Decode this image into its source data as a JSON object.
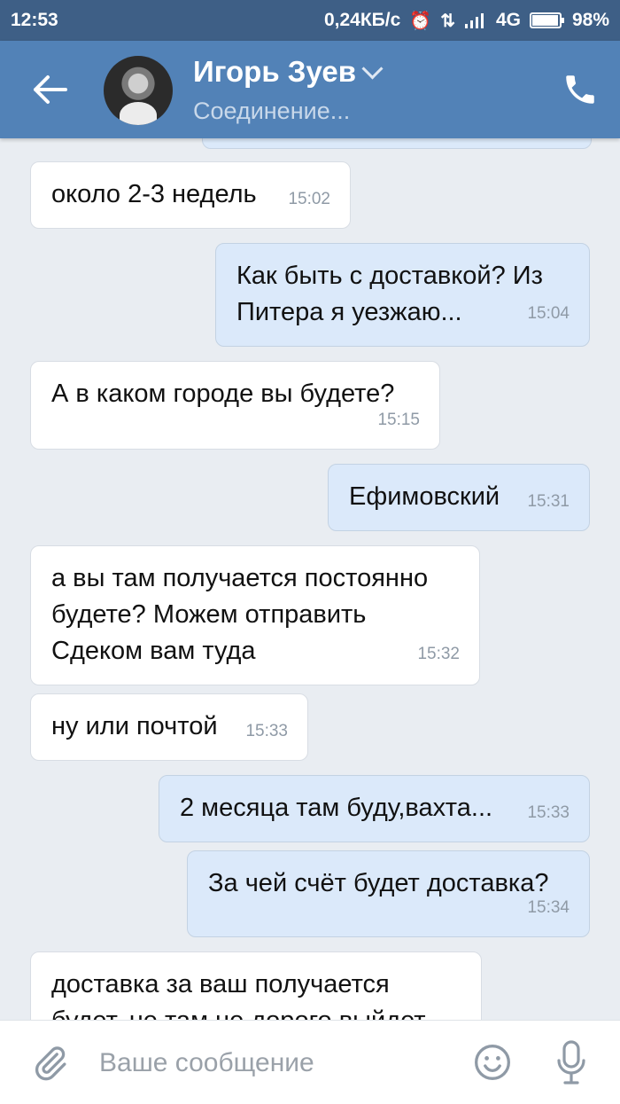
{
  "status_bar": {
    "time": "12:53",
    "net_speed": "0,24КБ/с",
    "network": "4G",
    "battery": "98%",
    "battery_level": 0.98,
    "icons": [
      "alarm-icon",
      "data-transfer-icon",
      "signal-icon",
      "battery-icon"
    ]
  },
  "header": {
    "contact_name": "Игорь Зуев",
    "status": "Соединение...",
    "icons": [
      "back-arrow-icon",
      "avatar",
      "chevron-down-icon",
      "phone-icon"
    ]
  },
  "messages": [
    {
      "dir": "in",
      "lines": [
        "около 2-3 недель"
      ],
      "time": "15:02"
    },
    {
      "dir": "out",
      "lines": [
        "Как быть с доставкой? Из",
        "Питера я уезжаю..."
      ],
      "time": "15:04"
    },
    {
      "dir": "in",
      "lines": [
        "А в каком городе вы будете?"
      ],
      "time": "15:15"
    },
    {
      "dir": "out",
      "lines": [
        "Ефимовский"
      ],
      "time": "15:31"
    },
    {
      "dir": "in",
      "lines": [
        "а вы там получается постоянно",
        "будете? Можем отправить",
        "Сдеком вам туда"
      ],
      "time": "15:32"
    },
    {
      "dir": "in",
      "lines": [
        "ну или почтой"
      ],
      "time": "15:33"
    },
    {
      "dir": "out",
      "lines": [
        "2 месяца там буду,вахта..."
      ],
      "time": "15:33"
    },
    {
      "dir": "out",
      "lines": [
        "За чей счёт будет доставка?"
      ],
      "time": "15:34"
    },
    {
      "dir": "in",
      "lines": [
        "доставка за ваш получается",
        "будет, не там не дорого выйдет"
      ],
      "time": ""
    }
  ],
  "input": {
    "placeholder": "Ваше сообщение",
    "icons": [
      "paperclip-icon",
      "emoji-icon",
      "microphone-icon"
    ]
  },
  "colors": {
    "header": "#5282b7",
    "status_bar": "#3e5f86",
    "background": "#e9edf2",
    "incoming_bubble": "#ffffff",
    "outgoing_bubble": "#dbe9fa"
  }
}
